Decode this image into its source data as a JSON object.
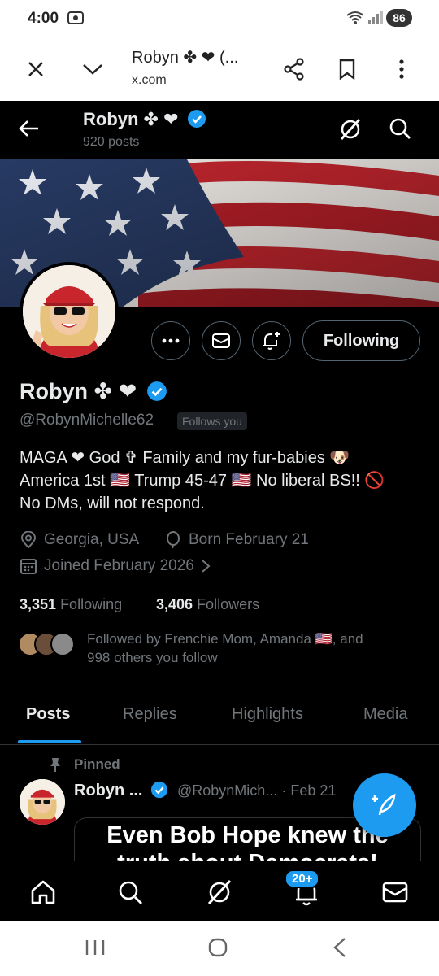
{
  "status_bar": {
    "time": "4:00",
    "battery": "86"
  },
  "browser": {
    "title": "Robyn ✤ ❤ (...",
    "url": "x.com"
  },
  "header": {
    "name": "Robyn ✤ ❤",
    "posts": "920 posts"
  },
  "profile": {
    "name": "Robyn ✤ ❤",
    "handle": "@RobynMichelle62",
    "follows_you": "Follows you",
    "following_button": "Following",
    "bio_line1": "MAGA ❤ God ✞ Family and my fur-babies 🐶",
    "bio_line2": "America 1st 🇺🇸 Trump 45-47 🇺🇸 No liberal BS!! 🚫",
    "bio_line3": "No DMs, will not respond.",
    "location": "Georgia, USA",
    "birthday": "Born February 21",
    "joined": "Joined February 2026",
    "following_count": "3,351",
    "following_label": "Following",
    "followers_count": "3,406",
    "followers_label": "Followers",
    "followed_by_line1": "Followed by Frenchie Mom, Amanda 🇺🇸, and",
    "followed_by_line2": "998 others you follow"
  },
  "tabs": [
    {
      "label": "Posts",
      "active": true
    },
    {
      "label": "Replies"
    },
    {
      "label": "Highlights"
    },
    {
      "label": "Media"
    }
  ],
  "pinned_post": {
    "pinned_label": "Pinned",
    "name": "Robyn ...",
    "handle": "@RobynMich...",
    "date": "· Feb 21",
    "card_text_line1": "Even Bob Hope knew the",
    "card_text_line2": "truth about Democrats!"
  },
  "bottom_nav": {
    "notifications_badge": "20+"
  },
  "icons": [
    "close-icon",
    "chevron-down-icon",
    "share-icon",
    "bookmark-icon",
    "more-vert-icon",
    "back-arrow-icon",
    "grok-icon",
    "search-icon",
    "more-icon",
    "message-icon",
    "notify-add-icon",
    "location-icon",
    "balloon-icon",
    "calendar-icon",
    "pin-icon",
    "verified-icon",
    "compose-icon",
    "home-icon",
    "bell-icon",
    "mail-icon"
  ],
  "colors": {
    "accent": "#1d9bf0",
    "background": "#000000",
    "secondary_text": "#71767b",
    "border": "#536471"
  }
}
